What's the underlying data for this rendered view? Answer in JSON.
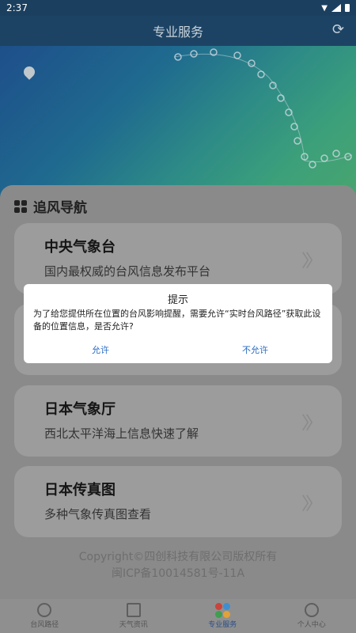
{
  "status": {
    "time": "2:37"
  },
  "header": {
    "title": "专业服务",
    "refresh_icon": "refresh-icon"
  },
  "section": {
    "title": "追风导航"
  },
  "cards": [
    {
      "title": "中央气象台",
      "subtitle": "国内最权威的台风信息发布平台"
    },
    {
      "title": "",
      "subtitle": ""
    },
    {
      "title": "日本气象厅",
      "subtitle": "西北太平洋海上信息快速了解"
    },
    {
      "title": "日本传真图",
      "subtitle": "多种气象传真图查看"
    }
  ],
  "footer": {
    "copyright": "Copyright©四创科技有限公司版权所有",
    "icp": "闽ICP备10014581号-11A"
  },
  "tabs": [
    {
      "label": "台风路径",
      "icon": "typhoon-path-icon"
    },
    {
      "label": "天气资讯",
      "icon": "news-icon"
    },
    {
      "label": "专业服务",
      "icon": "pro-service-icon"
    },
    {
      "label": "个人中心",
      "icon": "user-icon"
    }
  ],
  "dialog": {
    "title": "提示",
    "message": "为了给您提供所在位置的台风影响提醒，需要允许“实时台风路径”获取此设备的位置信息，是否允许?",
    "allow": "允许",
    "deny": "不允许"
  },
  "colors": {
    "header_bg": "#1d4364",
    "dialog_button": "#2b6cc4",
    "active_tab": "#2a4e84"
  }
}
